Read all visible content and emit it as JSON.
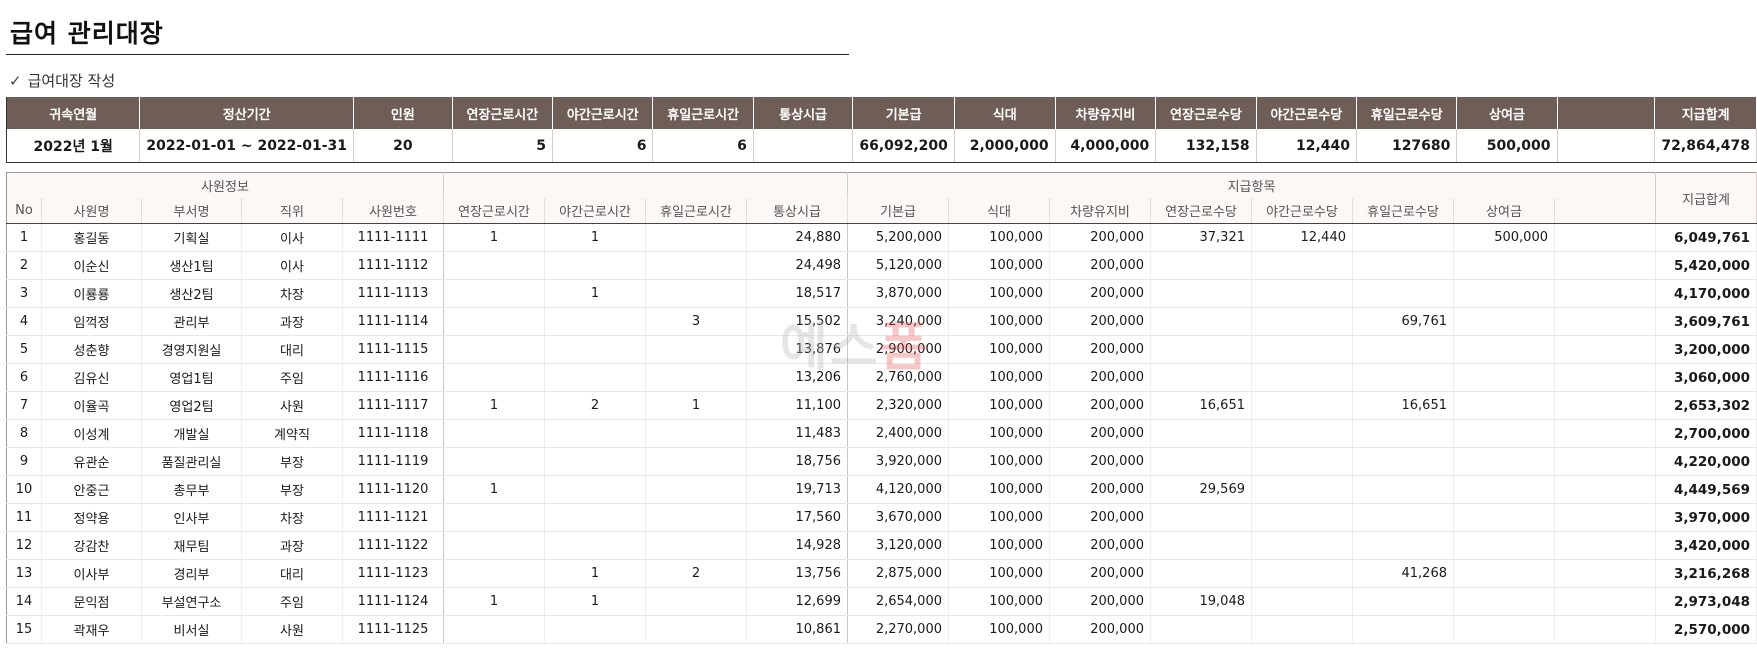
{
  "page": {
    "title": "급여 관리대장",
    "subtitle_check": "✓",
    "subtitle": "급여대장 작성",
    "watermark_a": "예스",
    "watermark_b": "폼"
  },
  "summary": {
    "headers": [
      "귀속연월",
      "정산기간",
      "인원",
      "연장근로시간",
      "야간근로시간",
      "휴일근로시간",
      "통상시급",
      "기본급",
      "식대",
      "차량유지비",
      "연장근로수당",
      "야간근로수당",
      "휴일근로수당",
      "상여금",
      "",
      "지급합계"
    ],
    "values": [
      "2022년 1월",
      "2022-01-01 ~ 2022-01-31",
      "20",
      "5",
      "6",
      "6",
      "",
      "66,092,200",
      "2,000,000",
      "4,000,000",
      "132,158",
      "12,440",
      "127680",
      "500,000",
      "",
      "72,864,478"
    ]
  },
  "detail": {
    "group_employee": "사원정보",
    "group_pay": "지급항목",
    "total_header": "지급합계",
    "headers": [
      "No",
      "사원명",
      "부서명",
      "직위",
      "사원번호",
      "연장근로시간",
      "야간근로시간",
      "휴일근로시간",
      "통상시급",
      "기본급",
      "식대",
      "차량유지비",
      "연장근로수당",
      "야간근로수당",
      "휴일근로수당",
      "상여금",
      ""
    ],
    "rows": [
      [
        "1",
        "홍길동",
        "기획실",
        "이사",
        "1111-1111",
        "1",
        "1",
        "",
        "24,880",
        "5,200,000",
        "100,000",
        "200,000",
        "37,321",
        "12,440",
        "",
        "500,000",
        "",
        "6,049,761"
      ],
      [
        "2",
        "이순신",
        "생산1팀",
        "이사",
        "1111-1112",
        "",
        "",
        "",
        "24,498",
        "5,120,000",
        "100,000",
        "200,000",
        "",
        "",
        "",
        "",
        "",
        "5,420,000"
      ],
      [
        "3",
        "이룡룡",
        "생산2팀",
        "차장",
        "1111-1113",
        "",
        "1",
        "",
        "18,517",
        "3,870,000",
        "100,000",
        "200,000",
        "",
        "",
        "",
        "",
        "",
        "4,170,000"
      ],
      [
        "4",
        "임꺽정",
        "관리부",
        "과장",
        "1111-1114",
        "",
        "",
        "3",
        "15,502",
        "3,240,000",
        "100,000",
        "200,000",
        "",
        "",
        "69,761",
        "",
        "",
        "3,609,761"
      ],
      [
        "5",
        "성춘향",
        "경영지원실",
        "대리",
        "1111-1115",
        "",
        "",
        "",
        "13,876",
        "2,900,000",
        "100,000",
        "200,000",
        "",
        "",
        "",
        "",
        "",
        "3,200,000"
      ],
      [
        "6",
        "김유신",
        "영업1팀",
        "주임",
        "1111-1116",
        "",
        "",
        "",
        "13,206",
        "2,760,000",
        "100,000",
        "200,000",
        "",
        "",
        "",
        "",
        "",
        "3,060,000"
      ],
      [
        "7",
        "이율곡",
        "영업2팀",
        "사원",
        "1111-1117",
        "1",
        "2",
        "1",
        "11,100",
        "2,320,000",
        "100,000",
        "200,000",
        "16,651",
        "",
        "16,651",
        "",
        "",
        "2,653,302"
      ],
      [
        "8",
        "이성계",
        "개발실",
        "계약직",
        "1111-1118",
        "",
        "",
        "",
        "11,483",
        "2,400,000",
        "100,000",
        "200,000",
        "",
        "",
        "",
        "",
        "",
        "2,700,000"
      ],
      [
        "9",
        "유관순",
        "품질관리실",
        "부장",
        "1111-1119",
        "",
        "",
        "",
        "18,756",
        "3,920,000",
        "100,000",
        "200,000",
        "",
        "",
        "",
        "",
        "",
        "4,220,000"
      ],
      [
        "10",
        "안중근",
        "총무부",
        "부장",
        "1111-1120",
        "1",
        "",
        "",
        "19,713",
        "4,120,000",
        "100,000",
        "200,000",
        "29,569",
        "",
        "",
        "",
        "",
        "4,449,569"
      ],
      [
        "11",
        "정약용",
        "인사부",
        "차장",
        "1111-1121",
        "",
        "",
        "",
        "17,560",
        "3,670,000",
        "100,000",
        "200,000",
        "",
        "",
        "",
        "",
        "",
        "3,970,000"
      ],
      [
        "12",
        "강감찬",
        "재무팀",
        "과장",
        "1111-1122",
        "",
        "",
        "",
        "14,928",
        "3,120,000",
        "100,000",
        "200,000",
        "",
        "",
        "",
        "",
        "",
        "3,420,000"
      ],
      [
        "13",
        "이사부",
        "경리부",
        "대리",
        "1111-1123",
        "",
        "1",
        "2",
        "13,756",
        "2,875,000",
        "100,000",
        "200,000",
        "",
        "",
        "41,268",
        "",
        "",
        "3,216,268"
      ],
      [
        "14",
        "문익점",
        "부설연구소",
        "주임",
        "1111-1124",
        "1",
        "1",
        "",
        "12,699",
        "2,654,000",
        "100,000",
        "200,000",
        "19,048",
        "",
        "",
        "",
        "",
        "2,973,048"
      ],
      [
        "15",
        "곽재우",
        "비서실",
        "사원",
        "1111-1125",
        "",
        "",
        "",
        "10,861",
        "2,270,000",
        "100,000",
        "200,000",
        "",
        "",
        "",
        "",
        "",
        "2,570,000"
      ]
    ]
  }
}
